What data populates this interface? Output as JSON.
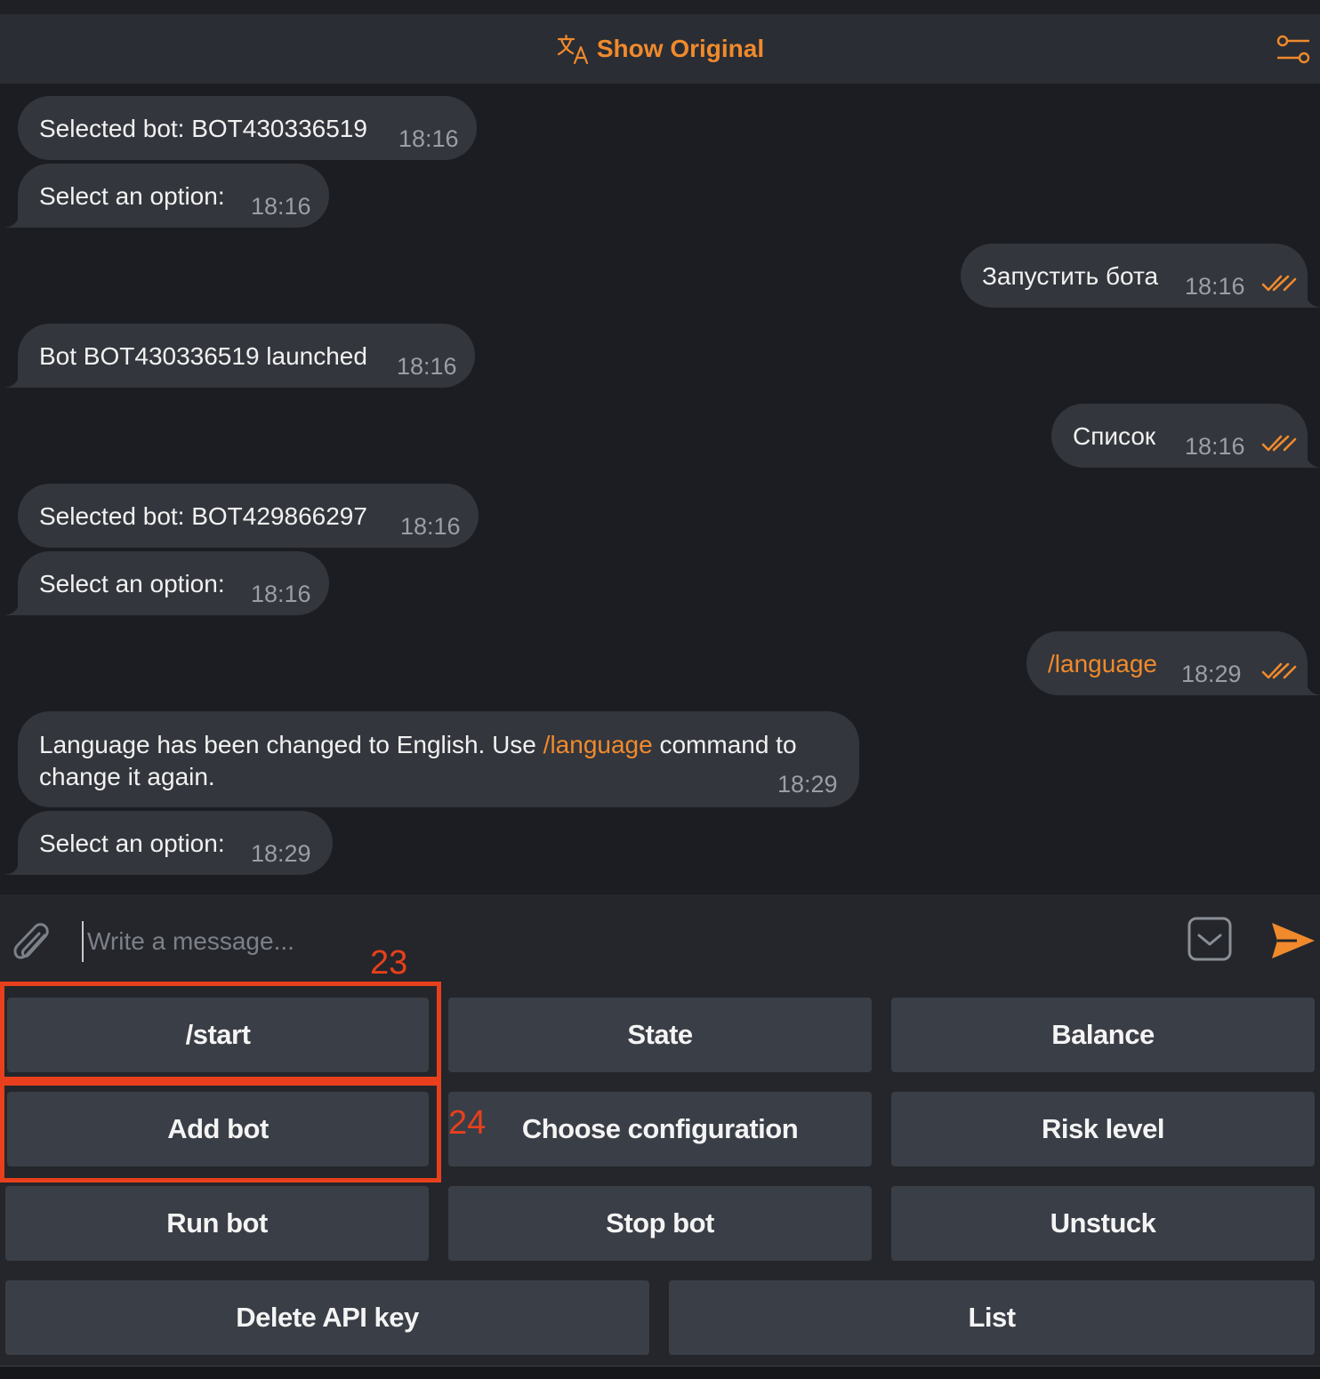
{
  "header": {
    "show_original_label": "Show Original",
    "translate_icon": "translate-icon",
    "settings_icon": "sliders-icon"
  },
  "messages": [
    {
      "direction": "incoming",
      "text": "Selected bot: BOT430336519",
      "time": "18:16"
    },
    {
      "direction": "incoming",
      "text": "Select an option:",
      "time": "18:16"
    },
    {
      "direction": "outgoing",
      "text": "Запустить бота",
      "time": "18:16",
      "read": true
    },
    {
      "direction": "incoming",
      "text": "Bot BOT430336519 launched",
      "time": "18:16"
    },
    {
      "direction": "outgoing",
      "text": "Список",
      "time": "18:16",
      "read": true
    },
    {
      "direction": "incoming",
      "text": "Selected bot: BOT429866297",
      "time": "18:16"
    },
    {
      "direction": "incoming",
      "text": "Select an option:",
      "time": "18:16"
    },
    {
      "direction": "outgoing",
      "text": "/language",
      "time": "18:29",
      "read": true
    },
    {
      "direction": "incoming",
      "text_part1": "Language has been changed to English. Use ",
      "command": "/language",
      "text_part2": " command to",
      "text_line2": "change it again.",
      "time": "18:29"
    },
    {
      "direction": "incoming",
      "text": "Select an option:",
      "time": "18:29"
    }
  ],
  "composer": {
    "placeholder": "Write a message...",
    "attach_icon": "paperclip-icon",
    "keyboard_icon": "bot-keyboard-icon",
    "send_icon": "send-icon"
  },
  "keyboard": {
    "rows": [
      [
        "/start",
        "State",
        "Balance"
      ],
      [
        "Add bot",
        "Choose configuration",
        "Risk level"
      ],
      [
        "Run bot",
        "Stop bot",
        "Unstuck"
      ],
      [
        "Delete API key",
        "List"
      ]
    ]
  },
  "annotations": [
    {
      "label": "23",
      "target": "/start"
    },
    {
      "label": "24",
      "target": "Add bot"
    }
  ],
  "colors": {
    "accent": "#f08a2c",
    "bubble": "#33363c",
    "background": "#1c1d22",
    "annotation": "#e8401c"
  }
}
